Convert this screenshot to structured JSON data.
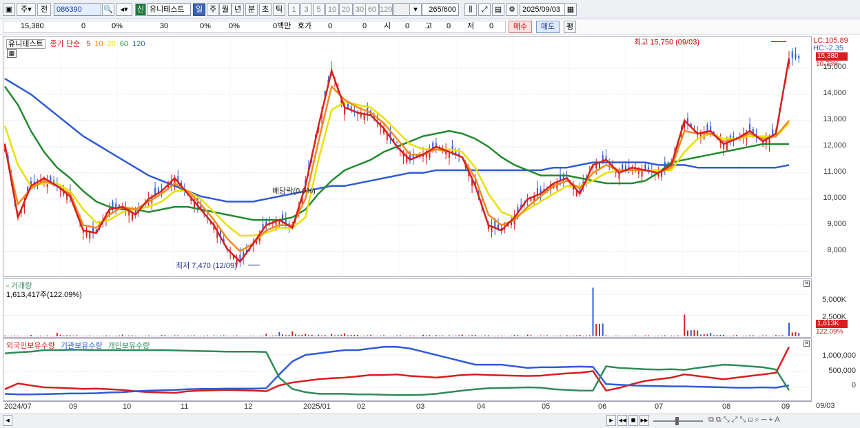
{
  "toolbar": {
    "mode1": "주",
    "mode2": "전",
    "stock_code": "086390",
    "badge": "신",
    "stock_name": "유니테스트",
    "periods": [
      "일",
      "주",
      "월",
      "년",
      "분",
      "초",
      "틱"
    ],
    "numbers": [
      "1",
      "3",
      "5",
      "10",
      "20",
      "30",
      "60",
      "120"
    ],
    "count": "265",
    "total": "/600",
    "date": "2025/09/03"
  },
  "info": {
    "price": "15,380",
    "c1": "0",
    "c2": "0%",
    "c3": "30",
    "c4": "0%",
    "c5": "0%",
    "c6": "0백만",
    "hoga": "호가",
    "c7": "0",
    "c8": "0",
    "si_label": "시",
    "si": "0",
    "go_label": "고",
    "go": "0",
    "jeo_label": "저",
    "jeo": "0",
    "buy": "매수",
    "sell": "매도",
    "pyeong": "평"
  },
  "legend": {
    "name": "유니테스트",
    "ma_label": "종가 단순",
    "ma": [
      {
        "p": "5",
        "color": "#d81e1e"
      },
      {
        "p": "10",
        "color": "#f08a1c"
      },
      {
        "p": "20",
        "color": "#e8e000"
      },
      {
        "p": "60",
        "color": "#1f8a2e"
      },
      {
        "p": "120",
        "color": "#2f5bd8"
      }
    ]
  },
  "price_axis": {
    "lc": "LC:105.89",
    "hc": "HC:-2.35",
    "current": "15,380",
    "pct": "10.73%",
    "ticks": [
      "15,000",
      "14,000",
      "13,000",
      "12,000",
      "11,000",
      "10,000",
      "9,000",
      "8,000"
    ]
  },
  "annotations": {
    "high": "최고 15,750 (09/03)",
    "low": "최저 7,470 (12/09)",
    "dividend": "배당락(0.0%)"
  },
  "volume": {
    "title": "거래량",
    "value": "1,613,417주(122.09%)",
    "ticks": [
      "5,000K",
      "2,500K"
    ],
    "current": "1,613K",
    "pct": "122.09%"
  },
  "holdings": {
    "series": [
      {
        "name": "외국인보유수량",
        "color": "#d81e1e"
      },
      {
        "name": "기관보유수량",
        "color": "#2f5bd8"
      },
      {
        "name": "개인보유수량",
        "color": "#2e8b57"
      }
    ],
    "ticks": [
      "1,000,000",
      "500,000",
      "0"
    ]
  },
  "x_axis": {
    "labels": [
      "2024/07",
      "09",
      "10",
      "11",
      "12",
      "2025/01",
      "02",
      "03",
      "04",
      "05",
      "06",
      "07",
      "08",
      "09"
    ],
    "right": "09/03"
  },
  "chart_data": {
    "type": "line",
    "title": "유니테스트",
    "x_range": [
      "2024/07",
      "2025/09/03"
    ],
    "ylim": [
      7470,
      15750
    ],
    "series": [
      {
        "name": "5",
        "values": [
          12100,
          9300,
          10500,
          10800,
          10500,
          10100,
          8800,
          8700,
          9600,
          9700,
          9400,
          10000,
          10300,
          10800,
          10200,
          9600,
          9000,
          8100,
          7600,
          8300,
          9000,
          9200,
          8900,
          10500,
          12800,
          14900,
          13500,
          13300,
          13200,
          12700,
          12000,
          11500,
          11700,
          12000,
          11800,
          11600,
          10500,
          9000,
          8800,
          9300,
          10000,
          10200,
          10600,
          10800,
          10200,
          11300,
          11500,
          11000,
          11200,
          11100,
          11000,
          11300,
          13000,
          12500,
          12600,
          12100,
          12300,
          12600,
          12200,
          12500,
          15380
        ]
      },
      {
        "name": "10",
        "values": [
          12000,
          9800,
          10400,
          10700,
          10500,
          10200,
          9000,
          8900,
          9400,
          9700,
          9600,
          9900,
          10200,
          10600,
          10300,
          9800,
          9200,
          8500,
          8000,
          8300,
          8800,
          9000,
          9000,
          10000,
          12200,
          14300,
          13800,
          13500,
          13300,
          12900,
          12300,
          11700,
          11700,
          11900,
          11800,
          11600,
          10800,
          9400,
          9000,
          9200,
          9700,
          10100,
          10500,
          10700,
          10400,
          11000,
          11300,
          11100,
          11100,
          11100,
          11000,
          11200,
          12600,
          12500,
          12500,
          12200,
          12300,
          12500,
          12300,
          12400,
          13000
        ]
      },
      {
        "name": "20",
        "values": [
          12800,
          11300,
          10500,
          10600,
          10600,
          10300,
          9600,
          9100,
          9200,
          9500,
          9600,
          9700,
          9900,
          10300,
          10300,
          10000,
          9500,
          9000,
          8600,
          8600,
          8700,
          8900,
          8900,
          9300,
          11500,
          13400,
          13700,
          13600,
          13500,
          13100,
          12600,
          12100,
          11900,
          11900,
          11900,
          11800,
          11200,
          10200,
          9500,
          9300,
          9600,
          9900,
          10200,
          10500,
          10500,
          10700,
          11000,
          11100,
          11100,
          11100,
          11100,
          11100,
          11800,
          12300,
          12500,
          12300,
          12300,
          12400,
          12400,
          12400,
          12900
        ]
      },
      {
        "name": "60",
        "values": [
          14300,
          13600,
          12600,
          11800,
          11200,
          10800,
          10300,
          9900,
          9700,
          9600,
          9600,
          9500,
          9600,
          9700,
          9700,
          9600,
          9500,
          9400,
          9300,
          9200,
          9200,
          9200,
          9300,
          9600,
          10200,
          10700,
          11100,
          11300,
          11500,
          11800,
          12000,
          12200,
          12400,
          12500,
          12600,
          12500,
          12300,
          12000,
          11600,
          11300,
          11100,
          10900,
          10900,
          10900,
          10800,
          10700,
          10600,
          10600,
          10600,
          10700,
          11000,
          11400,
          11500,
          11600,
          11700,
          11800,
          11900,
          12000,
          12100,
          12100,
          12100
        ]
      },
      {
        "name": "120",
        "values": [
          14600,
          14300,
          14000,
          13600,
          13200,
          12800,
          12400,
          12100,
          11800,
          11500,
          11200,
          10900,
          10700,
          10500,
          10300,
          10100,
          10000,
          9900,
          9900,
          9900,
          10000,
          10100,
          10200,
          10300,
          10400,
          10500,
          10500,
          10600,
          10700,
          10800,
          10900,
          11000,
          11000,
          11100,
          11100,
          11100,
          11100,
          11100,
          11100,
          11100,
          11100,
          11100,
          11200,
          11200,
          11300,
          11400,
          11400,
          11400,
          11400,
          11400,
          11300,
          11300,
          11300,
          11200,
          11200,
          11200,
          11200,
          11200,
          11200,
          11200,
          11300
        ]
      }
    ],
    "volume_K": [
      100,
      80,
      150,
      60,
      400,
      120,
      80,
      60,
      90,
      200,
      80,
      100,
      150,
      120,
      90,
      70,
      110,
      80,
      60,
      90,
      300,
      500,
      600,
      300,
      200,
      260,
      350,
      180,
      150,
      120,
      110,
      100,
      180,
      140,
      120,
      200,
      160,
      120,
      90,
      150,
      200,
      110,
      90,
      130,
      160,
      5800,
      120,
      90,
      80,
      110,
      90,
      100,
      2600,
      700,
      400,
      180,
      150,
      120,
      110,
      140,
      1613
    ],
    "holdings": [
      {
        "name": "외국인보유수량",
        "values": [
          -60000,
          120000,
          60000,
          0,
          -10000,
          -30000,
          -50000,
          -40000,
          -60000,
          -80000,
          -120000,
          -150000,
          -160000,
          -170000,
          -120000,
          -100000,
          -90000,
          -80000,
          -90000,
          -100000,
          -120000,
          60000,
          150000,
          200000,
          250000,
          280000,
          300000,
          340000,
          380000,
          380000,
          400000,
          350000,
          330000,
          300000,
          340000,
          380000,
          400000,
          380000,
          370000,
          360000,
          350000,
          360000,
          400000,
          430000,
          450000,
          500000,
          -100000,
          -20000,
          100000,
          200000,
          250000,
          300000,
          400000,
          350000,
          300000,
          250000,
          300000,
          350000,
          400000,
          450000,
          1250000
        ]
      },
      {
        "name": "기관보유수량",
        "values": [
          -200000,
          -220000,
          -220000,
          -210000,
          -200000,
          -190000,
          -190000,
          -180000,
          -160000,
          -150000,
          -120000,
          -100000,
          -90000,
          -80000,
          -60000,
          -50000,
          -50000,
          -40000,
          -40000,
          -40000,
          -30000,
          400000,
          800000,
          1000000,
          1050000,
          1100000,
          1150000,
          1150000,
          1200000,
          1250000,
          1250000,
          1200000,
          1100000,
          1000000,
          900000,
          800000,
          700000,
          700000,
          700000,
          650000,
          600000,
          620000,
          620000,
          630000,
          640000,
          630000,
          100000,
          80000,
          60000,
          50000,
          40000,
          30000,
          30000,
          20000,
          10000,
          0,
          -10000,
          -10000,
          0,
          -10000,
          60000
        ]
      },
      {
        "name": "개인보유수량",
        "values": [
          1050000,
          1080000,
          1100000,
          1150000,
          1150000,
          1160000,
          1160000,
          1150000,
          1150000,
          1150000,
          1150000,
          1150000,
          1150000,
          1140000,
          1130000,
          1120000,
          1110000,
          1100000,
          1100000,
          1100000,
          1090000,
          300000,
          -50000,
          -150000,
          -200000,
          -200000,
          -200000,
          -220000,
          -220000,
          -230000,
          -240000,
          -240000,
          -230000,
          -200000,
          -150000,
          -100000,
          -60000,
          -30000,
          -20000,
          -10000,
          0,
          -10000,
          -60000,
          -80000,
          -100000,
          -100000,
          650000,
          600000,
          580000,
          560000,
          550000,
          560000,
          540000,
          600000,
          650000,
          700000,
          680000,
          650000,
          620000,
          550000,
          -90000
        ]
      }
    ]
  }
}
